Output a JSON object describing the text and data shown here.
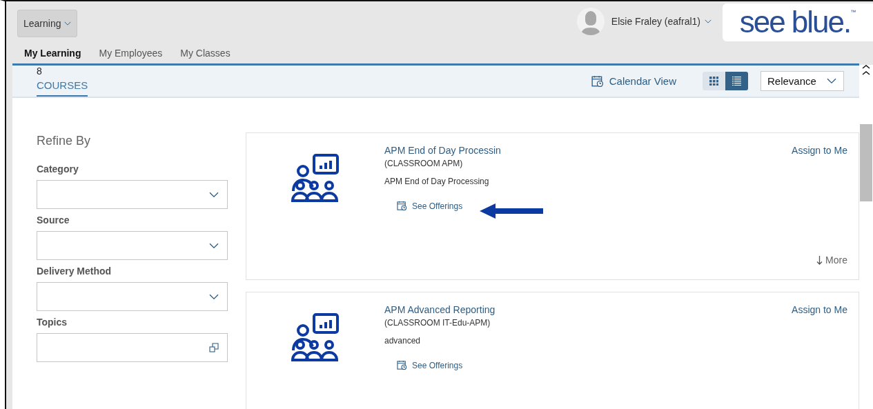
{
  "header": {
    "app_menu": "Learning",
    "user": "Elsie Fraley (eafral1)",
    "logo": "see blue.",
    "logo_mark": "™"
  },
  "tabs": [
    {
      "label": "My Learning",
      "selected": true
    },
    {
      "label": "My Employees",
      "selected": false
    },
    {
      "label": "My Classes",
      "selected": false
    }
  ],
  "results": {
    "count": "8",
    "label": "COURSES",
    "calendar_link": "Calendar View",
    "views": [
      {
        "kind": "grid",
        "selected": false
      },
      {
        "kind": "list",
        "selected": true
      }
    ],
    "sort": "Relevance"
  },
  "refine": {
    "title": "Refine By",
    "filters": [
      {
        "label": "Category",
        "kind": "dropdown"
      },
      {
        "label": "Source",
        "kind": "dropdown"
      },
      {
        "label": "Delivery Method",
        "kind": "dropdown"
      },
      {
        "label": "Topics",
        "kind": "value-help"
      }
    ]
  },
  "courses": [
    {
      "title": "APM End of Day Processin",
      "code": "(CLASSROOM APM)",
      "description": "APM End of Day Processing",
      "offerings": "See Offerings",
      "assign": "Assign to Me",
      "more": "More",
      "pointer_arrow": true
    },
    {
      "title": "APM Advanced Reporting",
      "code": "(CLASSROOM IT-Edu-APM)",
      "description": "advanced",
      "offerings": "See Offerings",
      "assign": "Assign to Me",
      "pointer_arrow": false
    }
  ]
}
